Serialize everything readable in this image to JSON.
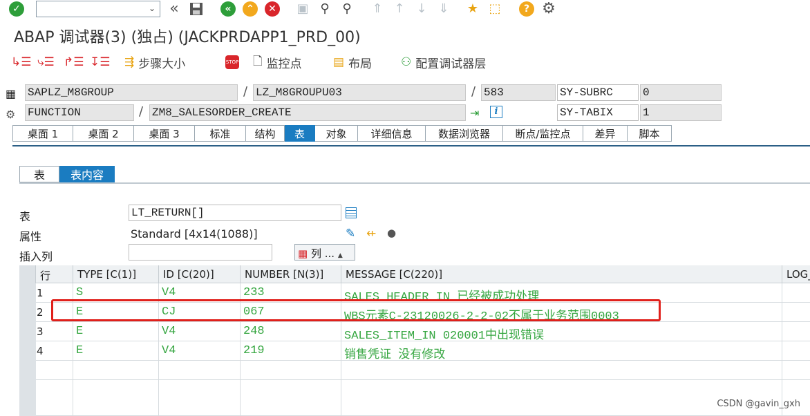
{
  "toolbar": {
    "command_field": "",
    "icons": [
      "check-icon",
      "dropdown-icon",
      "chevrons-left-icon",
      "save-icon",
      "back-icon",
      "up-icon",
      "cancel-icon",
      "print-icon",
      "find-icon",
      "find-next-icon",
      "first-page-icon",
      "prev-page-icon",
      "next-page-icon",
      "last-page-icon",
      "create-session-icon",
      "shortcut-icon",
      "help-icon",
      "settings-icon"
    ]
  },
  "window": {
    "title": "ABAP 调试器(3) (独占) (JACKPRDAPP1_PRD_00)"
  },
  "app_toolbar": {
    "step_size": "步骤大小",
    "watchpoints": "监控点",
    "layout": "布局",
    "configure": "配置调试器层"
  },
  "info": {
    "program": "SAPLZ_M8GROUP",
    "include": "LZ_M8GROUPU03",
    "line": "583",
    "sy_subrc_label": "SY-SUBRC",
    "sy_subrc_value": "0",
    "event_type": "FUNCTION",
    "event": "ZM8_SALESORDER_CREATE",
    "sy_tabix_label": "SY-TABIX",
    "sy_tabix_value": "1",
    "sep": "/"
  },
  "tabs": [
    "桌面 1",
    "桌面 2",
    "桌面 3",
    "标准",
    "结构",
    "表",
    "对象",
    "详细信息",
    "数据浏览器",
    "断点/监控点",
    "差异",
    "脚本"
  ],
  "active_tab": "表",
  "subtabs": [
    "表",
    "表内容"
  ],
  "table_panel": {
    "table_label": "表",
    "table_value": "LT_RETURN[]",
    "attr_label": "属性",
    "attr_value": "Standard [4x14(1088)]",
    "insert_col_label": "插入列",
    "insert_col_value": "",
    "columns_button": "列 ..."
  },
  "grid": {
    "headers": [
      "行",
      "TYPE [C(1)]",
      "ID [C(20)]",
      "NUMBER [N(3)]",
      "MESSAGE [C(220)]",
      "LOG_"
    ],
    "rows": [
      {
        "n": "1",
        "type": "S",
        "id": "V4",
        "number": "233",
        "message": "SALES_HEADER_IN 已经被成功处理"
      },
      {
        "n": "2",
        "type": "E",
        "id": "CJ",
        "number": "067",
        "message": "WBS元素C-23120026-2-2-02不属于业务范围0003"
      },
      {
        "n": "3",
        "type": "E",
        "id": "V4",
        "number": "248",
        "message": "SALES_ITEM_IN 020001中出现错误"
      },
      {
        "n": "4",
        "type": "E",
        "id": "V4",
        "number": "219",
        "message": "销售凭证  没有修改"
      }
    ],
    "text_color": "#35a640"
  },
  "highlight_color": "#e0201b",
  "watermark": "CSDN @gavin_gxh"
}
